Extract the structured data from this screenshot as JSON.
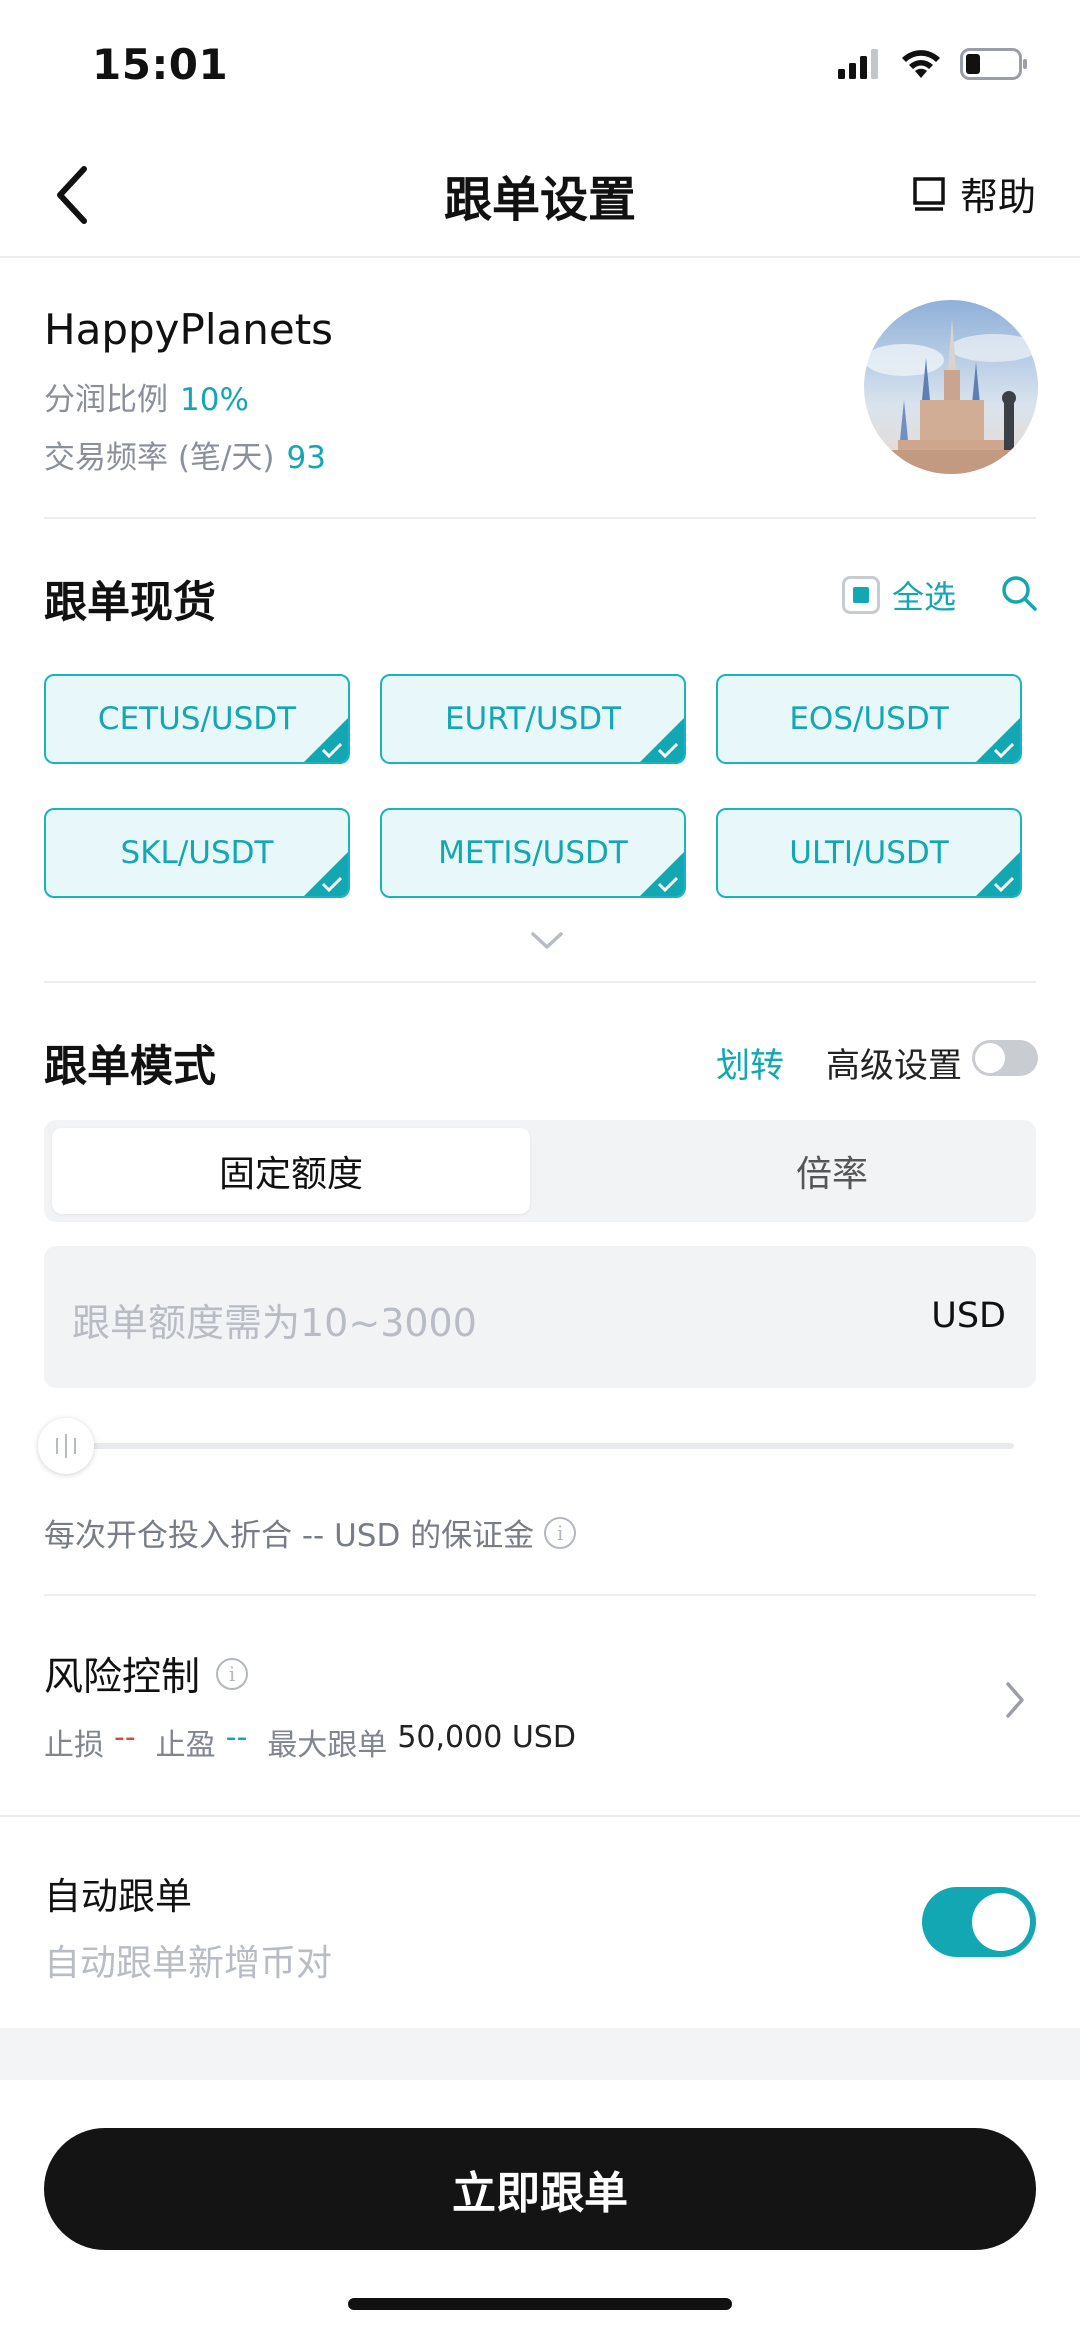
{
  "status_bar": {
    "time": "15:01",
    "icons": [
      "signal-icon",
      "wifi-icon",
      "battery-icon"
    ]
  },
  "nav": {
    "title": "跟单设置",
    "help_label": "帮助",
    "icons": [
      "back-icon",
      "help-icon"
    ]
  },
  "trader": {
    "name": "HappyPlanets",
    "profit_share_label": "分润比例",
    "profit_share_value": "10%",
    "frequency_label": "交易频率 (笔/天)",
    "frequency_value": "93"
  },
  "spot": {
    "title": "跟单现货",
    "select_all_label": "全选",
    "pairs": [
      "CETUS/USDT",
      "EURT/USDT",
      "EOS/USDT",
      "SKL/USDT",
      "METIS/USDT",
      "ULTI/USDT"
    ]
  },
  "mode": {
    "title": "跟单模式",
    "transfer_label": "划转",
    "advanced_label": "高级设置",
    "advanced_on": false,
    "tabs": [
      "固定额度",
      "倍率"
    ],
    "active_tab": "固定额度",
    "amount_placeholder": "跟单额度需为10~3000",
    "amount_unit": "USD",
    "slider_value": 0,
    "margin_note": "每次开仓投入折合 -- USD 的保证金"
  },
  "risk": {
    "title": "风险控制",
    "stop_loss_label": "止损",
    "stop_loss_value": "--",
    "take_profit_label": "止盈",
    "take_profit_value": "--",
    "max_label": "最大跟单",
    "max_value": "50,000 USD"
  },
  "auto_follow": {
    "title": "自动跟单",
    "subtitle": "自动跟单新增币对",
    "enabled": true
  },
  "cta_label": "立即跟单",
  "colors": {
    "accent": "#13a7b4",
    "stop_loss": "#e0463c",
    "cta_bg": "#141414"
  }
}
